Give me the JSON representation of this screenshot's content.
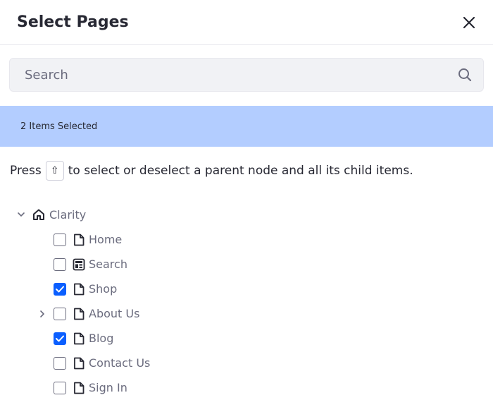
{
  "dialog": {
    "title": "Select Pages"
  },
  "search": {
    "placeholder": "Search",
    "value": ""
  },
  "selection": {
    "text": "2 Items Selected"
  },
  "hint": {
    "before": "Press",
    "key": "⇧",
    "after": "to select or deselect a parent node and all its child items."
  },
  "tree": {
    "root": {
      "label": "Clarity",
      "icon": "home-icon",
      "expanded": true
    },
    "items": [
      {
        "label": "Home",
        "icon": "page-icon",
        "checked": false,
        "has_children": false
      },
      {
        "label": "Search",
        "icon": "widget-page-icon",
        "checked": false,
        "has_children": false
      },
      {
        "label": "Shop",
        "icon": "page-icon",
        "checked": true,
        "has_children": false
      },
      {
        "label": "About Us",
        "icon": "page-icon",
        "checked": false,
        "has_children": true
      },
      {
        "label": "Blog",
        "icon": "page-icon",
        "checked": true,
        "has_children": false
      },
      {
        "label": "Contact Us",
        "icon": "page-icon",
        "checked": false,
        "has_children": false
      },
      {
        "label": "Sign In",
        "icon": "page-icon",
        "checked": false,
        "has_children": false
      }
    ]
  },
  "colors": {
    "accent": "#0b5fff",
    "selection_bar": "#b3cdff",
    "text_primary": "#272833",
    "text_secondary": "#6b6c7e"
  }
}
